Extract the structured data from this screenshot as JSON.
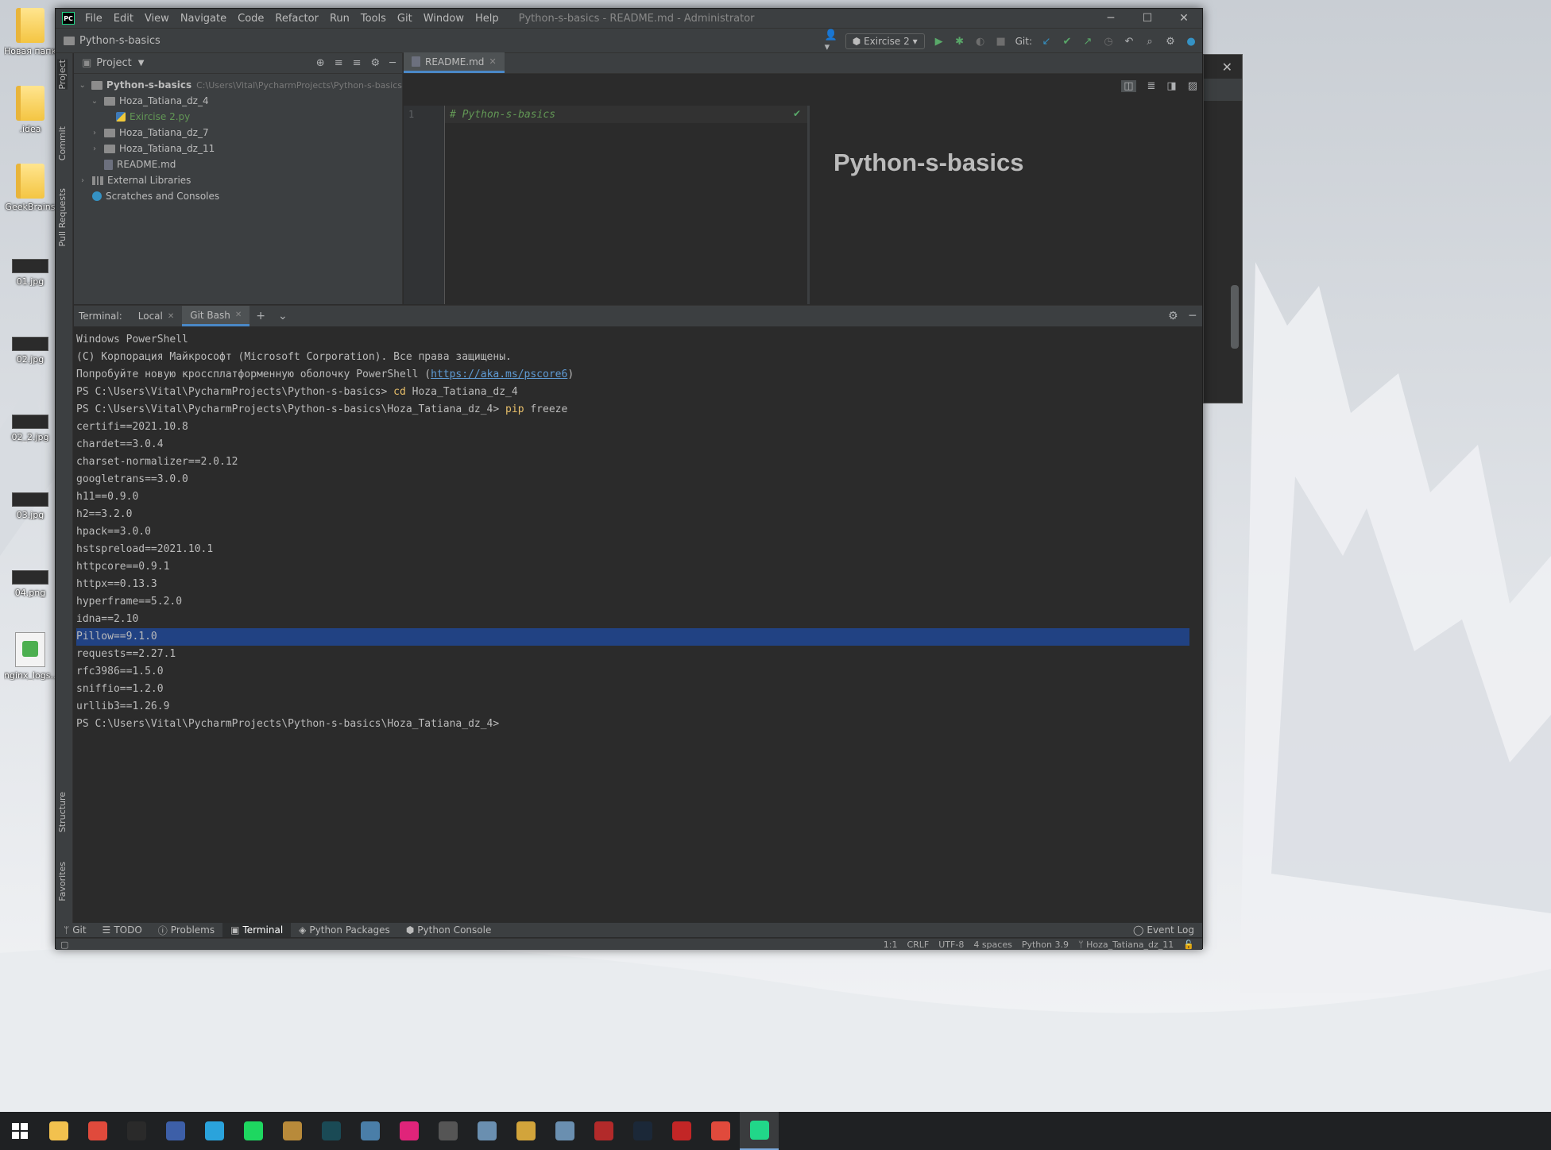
{
  "desktop": {
    "icons": [
      {
        "label": "Новая папка",
        "kind": "folder"
      },
      {
        "label": ".idea",
        "kind": "folder"
      },
      {
        "label": "GeekBrains",
        "kind": "folder"
      },
      {
        "label": "01.jpg",
        "kind": "image"
      },
      {
        "label": "02.jpg",
        "kind": "image"
      },
      {
        "label": "02_2.jpg",
        "kind": "image"
      },
      {
        "label": "03.jpg",
        "kind": "image"
      },
      {
        "label": "04.png",
        "kind": "image"
      },
      {
        "label": "nginx_logs...",
        "kind": "file"
      }
    ]
  },
  "window": {
    "menu": [
      "File",
      "Edit",
      "View",
      "Navigate",
      "Code",
      "Refactor",
      "Run",
      "Tools",
      "Git",
      "Window",
      "Help"
    ],
    "title": "Python-s-basics - README.md - Administrator",
    "controls": {
      "minimize": "─",
      "maximize": "☐",
      "close": "✕"
    }
  },
  "navbar": {
    "breadcrumb": "Python-s-basics",
    "run_config": "Exircise 2",
    "git_label": "Git:"
  },
  "left_strip": {
    "tabs": [
      "Project",
      "Commit",
      "Pull Requests",
      "Structure",
      "Favorites"
    ]
  },
  "project": {
    "header": "Project",
    "tree": [
      {
        "name": "Python-s-basics",
        "path": "C:\\Users\\Vital\\PycharmProjects\\Python-s-basics",
        "level": 0,
        "arrow": "⌄",
        "type": "root"
      },
      {
        "name": "Hoza_Tatiana_dz_4",
        "level": 1,
        "arrow": "⌄",
        "type": "folder"
      },
      {
        "name": "Exircise 2.py",
        "level": 2,
        "arrow": "",
        "type": "py"
      },
      {
        "name": "Hoza_Tatiana_dz_7",
        "level": 1,
        "arrow": "›",
        "type": "folder"
      },
      {
        "name": "Hoza_Tatiana_dz_11",
        "level": 1,
        "arrow": "›",
        "type": "folder"
      },
      {
        "name": "README.md",
        "level": 1,
        "arrow": "",
        "type": "md"
      },
      {
        "name": "External Libraries",
        "level": 0,
        "arrow": "›",
        "type": "lib"
      },
      {
        "name": "Scratches and Consoles",
        "level": 0,
        "arrow": "",
        "type": "scratch"
      }
    ]
  },
  "editor": {
    "tab": "README.md",
    "line_number": "1",
    "code": "# Python-s-basics",
    "preview_heading": "Python-s-basics"
  },
  "terminal": {
    "label": "Terminal:",
    "tabs": [
      {
        "name": "Local",
        "active": false
      },
      {
        "name": "Git Bash",
        "active": true
      }
    ],
    "lines": [
      {
        "segments": [
          {
            "t": "Windows PowerShell"
          }
        ]
      },
      {
        "segments": [
          {
            "t": "(C) Корпорация Майкрософт (Microsoft Corporation). Все права защищены."
          }
        ]
      },
      {
        "segments": [
          {
            "t": "Попробуйте новую кроссплатформенную оболочку PowerShell ("
          },
          {
            "t": "https://aka.ms/pscore6",
            "cls": "link"
          },
          {
            "t": ")"
          }
        ]
      },
      {
        "segments": [
          {
            "t": "PS C:\\Users\\Vital\\PycharmProjects\\Python-s-basics> "
          },
          {
            "t": "cd",
            "cls": "cmd"
          },
          {
            "t": " Hoza_Tatiana_dz_4"
          }
        ]
      },
      {
        "segments": [
          {
            "t": "PS C:\\Users\\Vital\\PycharmProjects\\Python-s-basics\\Hoza_Tatiana_dz_4> "
          },
          {
            "t": "pip",
            "cls": "cmd"
          },
          {
            "t": " freeze"
          }
        ]
      },
      {
        "segments": [
          {
            "t": "certifi==2021.10.8"
          }
        ]
      },
      {
        "segments": [
          {
            "t": "chardet==3.0.4"
          }
        ]
      },
      {
        "segments": [
          {
            "t": "charset-normalizer==2.0.12"
          }
        ]
      },
      {
        "segments": [
          {
            "t": "googletrans==3.0.0"
          }
        ]
      },
      {
        "segments": [
          {
            "t": "h11==0.9.0"
          }
        ]
      },
      {
        "segments": [
          {
            "t": "h2==3.2.0"
          }
        ]
      },
      {
        "segments": [
          {
            "t": "hpack==3.0.0"
          }
        ]
      },
      {
        "segments": [
          {
            "t": "hstspreload==2021.10.1"
          }
        ]
      },
      {
        "segments": [
          {
            "t": "httpcore==0.9.1"
          }
        ]
      },
      {
        "segments": [
          {
            "t": "httpx==0.13.3"
          }
        ]
      },
      {
        "segments": [
          {
            "t": "hyperframe==5.2.0"
          }
        ]
      },
      {
        "segments": [
          {
            "t": "idna==2.10"
          }
        ]
      },
      {
        "segments": [
          {
            "t": "Pillow==9.1.0"
          }
        ],
        "highlight": true
      },
      {
        "segments": [
          {
            "t": "requests==2.27.1"
          }
        ]
      },
      {
        "segments": [
          {
            "t": "rfc3986==1.5.0"
          }
        ]
      },
      {
        "segments": [
          {
            "t": "sniffio==1.2.0"
          }
        ]
      },
      {
        "segments": [
          {
            "t": "urllib3==1.26.9"
          }
        ]
      },
      {
        "segments": [
          {
            "t": "PS C:\\Users\\Vital\\PycharmProjects\\Python-s-basics\\Hoza_Tatiana_dz_4>"
          }
        ]
      }
    ]
  },
  "tool_tabs": [
    {
      "name": "Git",
      "icon": "branch-icon"
    },
    {
      "name": "TODO",
      "icon": "list-icon"
    },
    {
      "name": "Problems",
      "icon": "info-icon"
    },
    {
      "name": "Terminal",
      "icon": "terminal-icon",
      "active": true
    },
    {
      "name": "Python Packages",
      "icon": "packages-icon"
    },
    {
      "name": "Python Console",
      "icon": "python-icon"
    }
  ],
  "event_log": "Event Log",
  "status": {
    "position": "1:1",
    "line_sep": "CRLF",
    "encoding": "UTF-8",
    "indent": "4 spaces",
    "interpreter": "Python 3.9",
    "branch": "Hoza_Tatiana_dz_11"
  },
  "taskbar": {
    "apps": [
      {
        "name": "file-explorer-icon",
        "color": "#f2c14e"
      },
      {
        "name": "chrome-icon",
        "color": "#e04a3c"
      },
      {
        "name": "epic-games-icon",
        "color": "#2a2a2a"
      },
      {
        "name": "save-icon",
        "color": "#3d5fa8"
      },
      {
        "name": "telegram-icon",
        "color": "#2aa3dc"
      },
      {
        "name": "spotify-icon",
        "color": "#1ed760"
      },
      {
        "name": "game-icon",
        "color": "#b88a3a"
      },
      {
        "name": "app-icon",
        "color": "#1a4a55"
      },
      {
        "name": "app2-icon",
        "color": "#4a7ea8"
      },
      {
        "name": "forza-icon",
        "color": "#e0247a"
      },
      {
        "name": "circle-app-icon",
        "color": "#555555"
      },
      {
        "name": "globe-icon",
        "color": "#6a8fb0"
      },
      {
        "name": "game2-icon",
        "color": "#d2a43b"
      },
      {
        "name": "globe2-icon",
        "color": "#6a8fb0"
      },
      {
        "name": "game3-icon",
        "color": "#b22a2a"
      },
      {
        "name": "steam-icon",
        "color": "#1b2838"
      },
      {
        "name": "red-app-icon",
        "color": "#c22626"
      },
      {
        "name": "chrome2-icon",
        "color": "#e04a3c"
      },
      {
        "name": "pycharm-icon",
        "color": "#21d789"
      }
    ]
  }
}
